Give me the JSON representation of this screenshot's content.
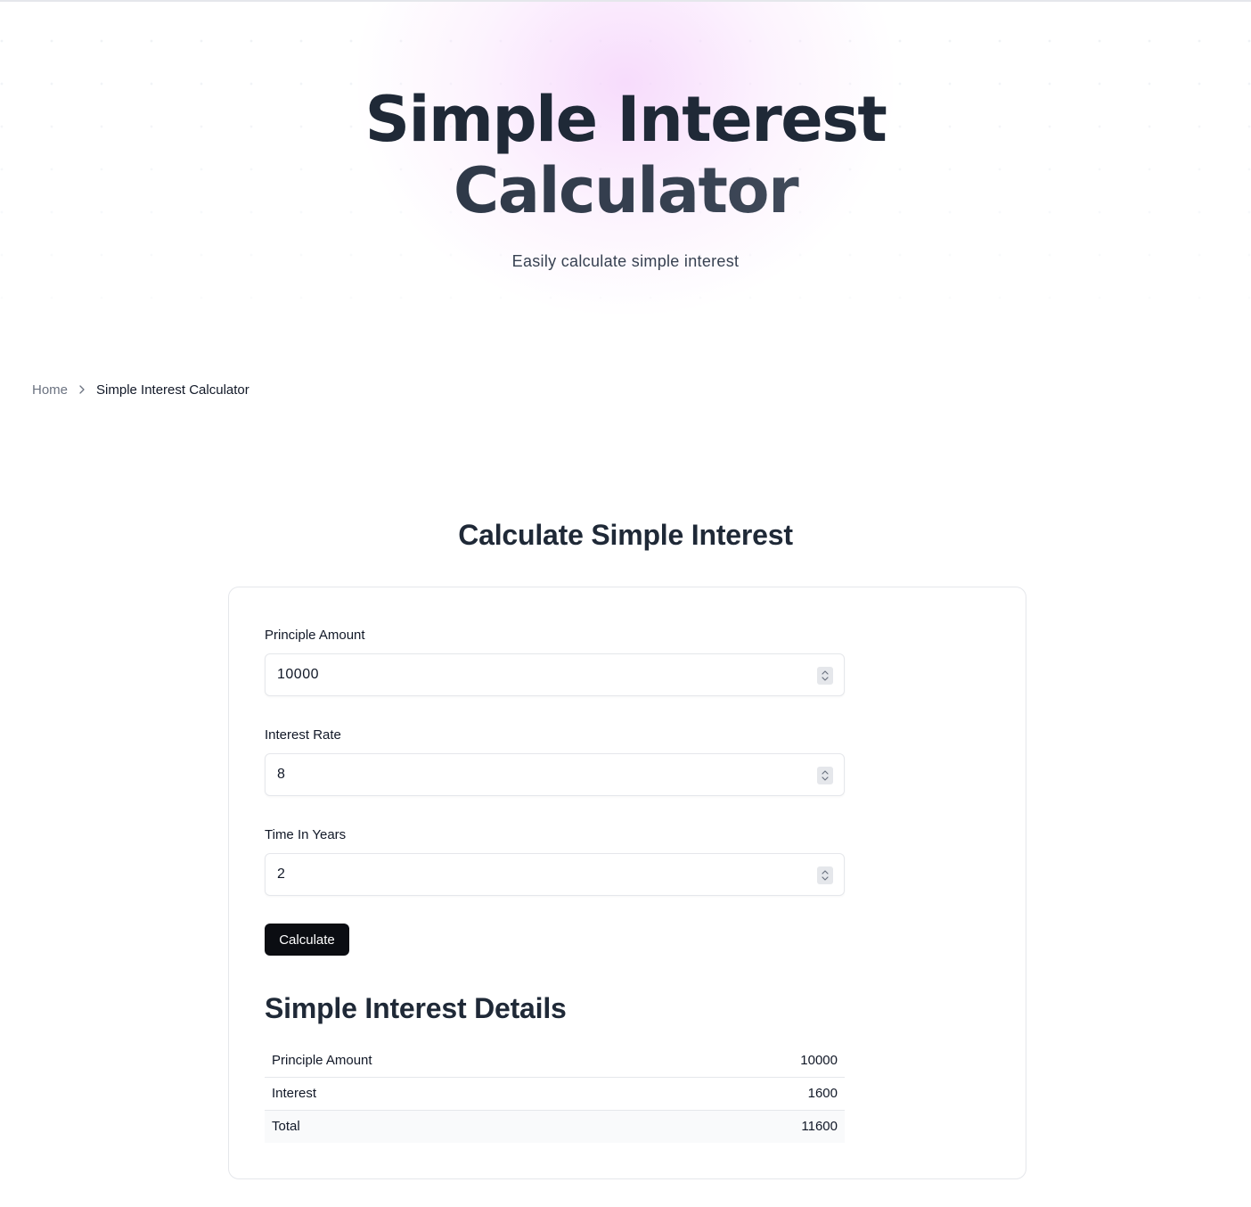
{
  "hero": {
    "title_line1": "Simple Interest",
    "title_line2": "Calculator",
    "subtitle": "Easily calculate simple interest"
  },
  "breadcrumb": {
    "home": "Home",
    "current": "Simple Interest Calculator"
  },
  "calculator": {
    "section_title": "Calculate Simple Interest",
    "fields": [
      {
        "label": "Principle Amount",
        "value": "10000"
      },
      {
        "label": "Interest Rate",
        "value": "8"
      },
      {
        "label": "Time In Years",
        "value": "2"
      }
    ],
    "calculate_label": "Calculate"
  },
  "details": {
    "title": "Simple Interest Details",
    "rows": [
      {
        "label": "Principle Amount",
        "value": "10000"
      },
      {
        "label": "Interest",
        "value": "1600"
      },
      {
        "label": "Total",
        "value": "11600"
      }
    ]
  },
  "icons": {
    "breadcrumb_separator": "chevron-right-icon",
    "stepper": "chevron-up-down-icon"
  },
  "colors": {
    "button_bg": "#0b0d12",
    "hero_glow": "#f4d0fb",
    "heading": "#1f2937"
  }
}
